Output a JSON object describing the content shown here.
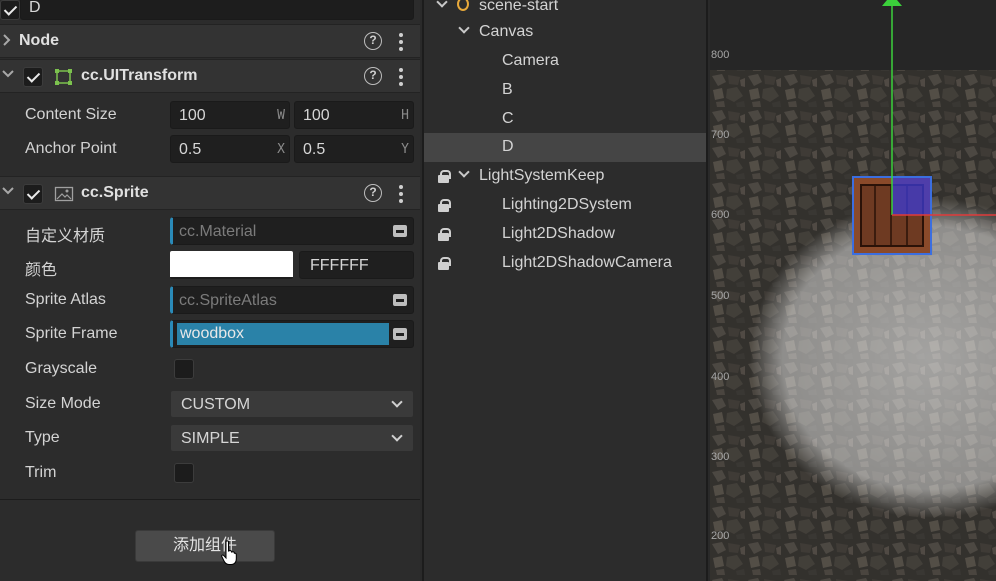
{
  "inspector": {
    "node_name": "D",
    "node_section": {
      "title": "Node"
    },
    "ui_transform": {
      "title": "cc.UITransform",
      "content_size": {
        "label": "Content Size",
        "w": "100",
        "w_suffix": "W",
        "h": "100",
        "h_suffix": "H"
      },
      "anchor_point": {
        "label": "Anchor Point",
        "x": "0.5",
        "x_suffix": "X",
        "y": "0.5",
        "y_suffix": "Y"
      }
    },
    "sprite": {
      "title": "cc.Sprite",
      "custom_material": {
        "label": "自定义材质",
        "value": "cc.Material"
      },
      "color": {
        "label": "颜色",
        "hex": "FFFFFF",
        "swatch": "#ffffff"
      },
      "sprite_atlas": {
        "label": "Sprite Atlas",
        "value": "cc.SpriteAtlas"
      },
      "sprite_frame": {
        "label": "Sprite Frame",
        "value": "woodbox"
      },
      "grayscale": {
        "label": "Grayscale",
        "checked": false
      },
      "size_mode": {
        "label": "Size Mode",
        "value": "CUSTOM"
      },
      "type": {
        "label": "Type",
        "value": "SIMPLE"
      },
      "trim": {
        "label": "Trim",
        "checked": false
      }
    },
    "add_component_label": "添加组件"
  },
  "hierarchy": {
    "items": [
      {
        "label": "scene-start",
        "type": "scene",
        "expanded": true
      },
      {
        "label": "Canvas",
        "expanded": true
      },
      {
        "label": "Camera"
      },
      {
        "label": "B"
      },
      {
        "label": "C"
      },
      {
        "label": "D",
        "selected": true
      },
      {
        "label": "LightSystemKeep",
        "locked": true,
        "expanded": true
      },
      {
        "label": "Lighting2DSystem",
        "locked": true
      },
      {
        "label": "Light2DShadow",
        "locked": true
      },
      {
        "label": "Light2DShadowCamera",
        "locked": true
      }
    ]
  },
  "scene_view": {
    "ruler_labels": [
      "800",
      "700",
      "600",
      "500",
      "400",
      "300",
      "200"
    ]
  },
  "colors": {
    "accent": "#2a82a8",
    "selection": "#454545",
    "gizmo_y": "#3bd13b",
    "gizmo_x": "#e03b3b",
    "selection_box": "#3b6ee0"
  }
}
